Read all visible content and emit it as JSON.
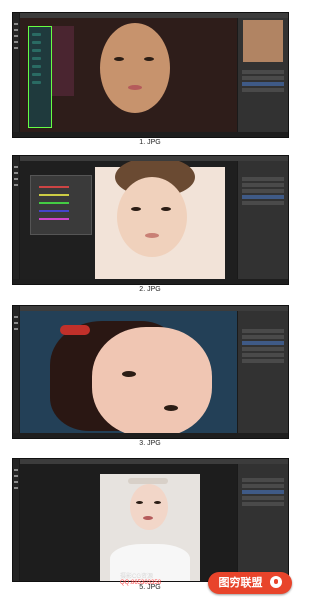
{
  "screens": [
    {
      "caption": "1. JPG"
    },
    {
      "caption": "2. JPG"
    },
    {
      "caption": "3. JPG"
    },
    {
      "caption": "5. JPG"
    }
  ],
  "watermark": {
    "line1": "摄影CG资源",
    "line2": "QQ:865303358"
  },
  "brand": {
    "label": "图穷联盟",
    "color": "#e8442b"
  },
  "colors": {
    "app_bg": "#2b2b2b",
    "panel_bg": "#323232",
    "selected_layer": "#3f5a86"
  }
}
